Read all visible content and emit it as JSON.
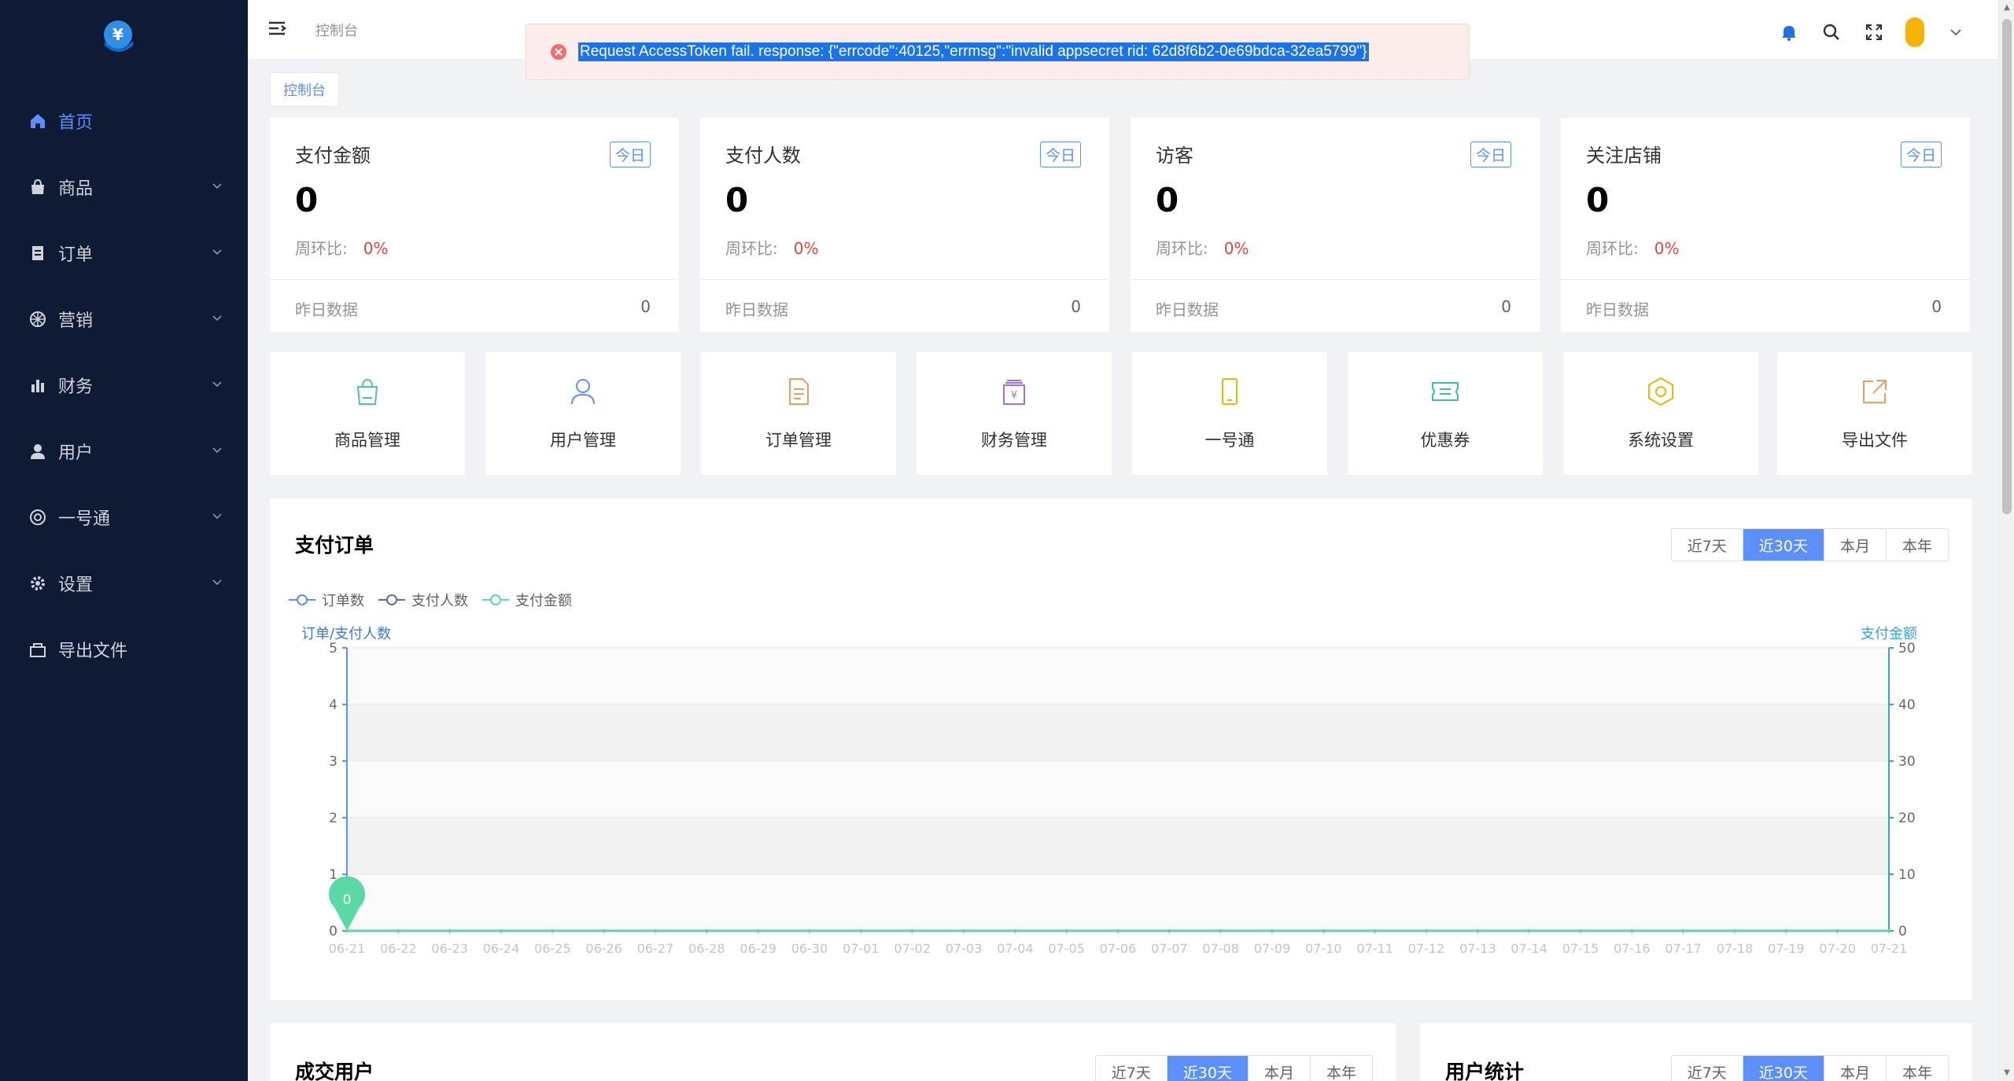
{
  "sidebar": {
    "items": [
      {
        "label": "首页",
        "icon": "home-icon",
        "active": true
      },
      {
        "label": "商品",
        "icon": "bag-icon"
      },
      {
        "label": "订单",
        "icon": "order-icon"
      },
      {
        "label": "营销",
        "icon": "marketing-icon"
      },
      {
        "label": "财务",
        "icon": "finance-icon"
      },
      {
        "label": "用户",
        "icon": "user-icon"
      },
      {
        "label": "一号通",
        "icon": "yihaotong-icon"
      },
      {
        "label": "设置",
        "icon": "gear-icon"
      },
      {
        "label": "导出文件",
        "icon": "export-icon"
      }
    ]
  },
  "header": {
    "breadcrumb": "控制台"
  },
  "toast": {
    "message": "Request AccessToken fail. response: {\"errcode\":40125,\"errmsg\":\"invalid appsecret rid: 62d8f6b2-0e69bdca-32ea5799\"}"
  },
  "tag": "控制台",
  "stats": [
    {
      "title": "支付金额",
      "badge": "今日",
      "value": "0",
      "ratio_label": "周环比:",
      "ratio": "0%",
      "y_label": "昨日数据",
      "y_value": "0"
    },
    {
      "title": "支付人数",
      "badge": "今日",
      "value": "0",
      "ratio_label": "周环比:",
      "ratio": "0%",
      "y_label": "昨日数据",
      "y_value": "0"
    },
    {
      "title": "访客",
      "badge": "今日",
      "value": "0",
      "ratio_label": "周环比:",
      "ratio": "0%",
      "y_label": "昨日数据",
      "y_value": "0"
    },
    {
      "title": "关注店铺",
      "badge": "今日",
      "value": "0",
      "ratio_label": "周环比:",
      "ratio": "0%",
      "y_label": "昨日数据",
      "y_value": "0"
    }
  ],
  "quick_nav": [
    {
      "label": "商品管理",
      "icon": "shopping-bag-icon",
      "color": "#4cc7a3"
    },
    {
      "label": "用户管理",
      "icon": "person-icon",
      "color": "#5b8ff9"
    },
    {
      "label": "订单管理",
      "icon": "document-icon",
      "color": "#f29c5a"
    },
    {
      "label": "财务管理",
      "icon": "cash-register-icon",
      "color": "#a071e6"
    },
    {
      "label": "一号通",
      "icon": "phone-icon",
      "color": "#f5b400"
    },
    {
      "label": "优惠券",
      "icon": "ticket-icon",
      "color": "#3fbfa6"
    },
    {
      "label": "系统设置",
      "icon": "hex-gear-icon",
      "color": "#f5b400"
    },
    {
      "label": "导出文件",
      "icon": "external-link-icon",
      "color": "#f29c5a"
    }
  ],
  "order_panel": {
    "title": "支付订单",
    "ranges": [
      "近7天",
      "近30天",
      "本月",
      "本年"
    ],
    "active_range": 1
  },
  "chart_data": {
    "type": "line",
    "legend": [
      "订单数",
      "支付人数",
      "支付金额"
    ],
    "left_axis_label": "订单/支付人数",
    "right_axis_label": "支付金额",
    "left_ticks": [
      0,
      1,
      2,
      3,
      4,
      5
    ],
    "right_ticks": [
      0,
      10,
      20,
      30,
      40,
      50
    ],
    "ylim_left": [
      0,
      5
    ],
    "ylim_right": [
      0,
      50
    ],
    "x": [
      "06-21",
      "06-22",
      "06-23",
      "06-24",
      "06-25",
      "06-26",
      "06-27",
      "06-28",
      "06-29",
      "06-30",
      "07-01",
      "07-02",
      "07-03",
      "07-04",
      "07-05",
      "07-06",
      "07-07",
      "07-08",
      "07-09",
      "07-10",
      "07-11",
      "07-12",
      "07-13",
      "07-14",
      "07-15",
      "07-16",
      "07-17",
      "07-18",
      "07-19",
      "07-20",
      "07-21"
    ],
    "series": [
      {
        "name": "订单数",
        "color": "#5b8ff9",
        "values": [
          0,
          0,
          0,
          0,
          0,
          0,
          0,
          0,
          0,
          0,
          0,
          0,
          0,
          0,
          0,
          0,
          0,
          0,
          0,
          0,
          0,
          0,
          0,
          0,
          0,
          0,
          0,
          0,
          0,
          0,
          0
        ]
      },
      {
        "name": "支付人数",
        "color": "#5d7092",
        "values": [
          0,
          0,
          0,
          0,
          0,
          0,
          0,
          0,
          0,
          0,
          0,
          0,
          0,
          0,
          0,
          0,
          0,
          0,
          0,
          0,
          0,
          0,
          0,
          0,
          0,
          0,
          0,
          0,
          0,
          0,
          0
        ]
      },
      {
        "name": "支付金额",
        "color": "#5ad8a6",
        "values": [
          0,
          0,
          0,
          0,
          0,
          0,
          0,
          0,
          0,
          0,
          0,
          0,
          0,
          0,
          0,
          0,
          0,
          0,
          0,
          0,
          0,
          0,
          0,
          0,
          0,
          0,
          0,
          0,
          0,
          0,
          0
        ]
      }
    ],
    "marker": {
      "label": "0",
      "color": "#5ad8a6"
    }
  },
  "bottom_panels": [
    {
      "title": "成交用户",
      "ranges": [
        "近7天",
        "近30天",
        "本月",
        "本年"
      ],
      "active_range": 1
    },
    {
      "title": "用户统计",
      "ranges": [
        "近7天",
        "近30天",
        "本月",
        "本年"
      ],
      "active_range": 1
    }
  ],
  "colors": {
    "sidebar_bg": "#0f1a35",
    "accent": "#5b8ff9",
    "danger": "#e64340"
  }
}
